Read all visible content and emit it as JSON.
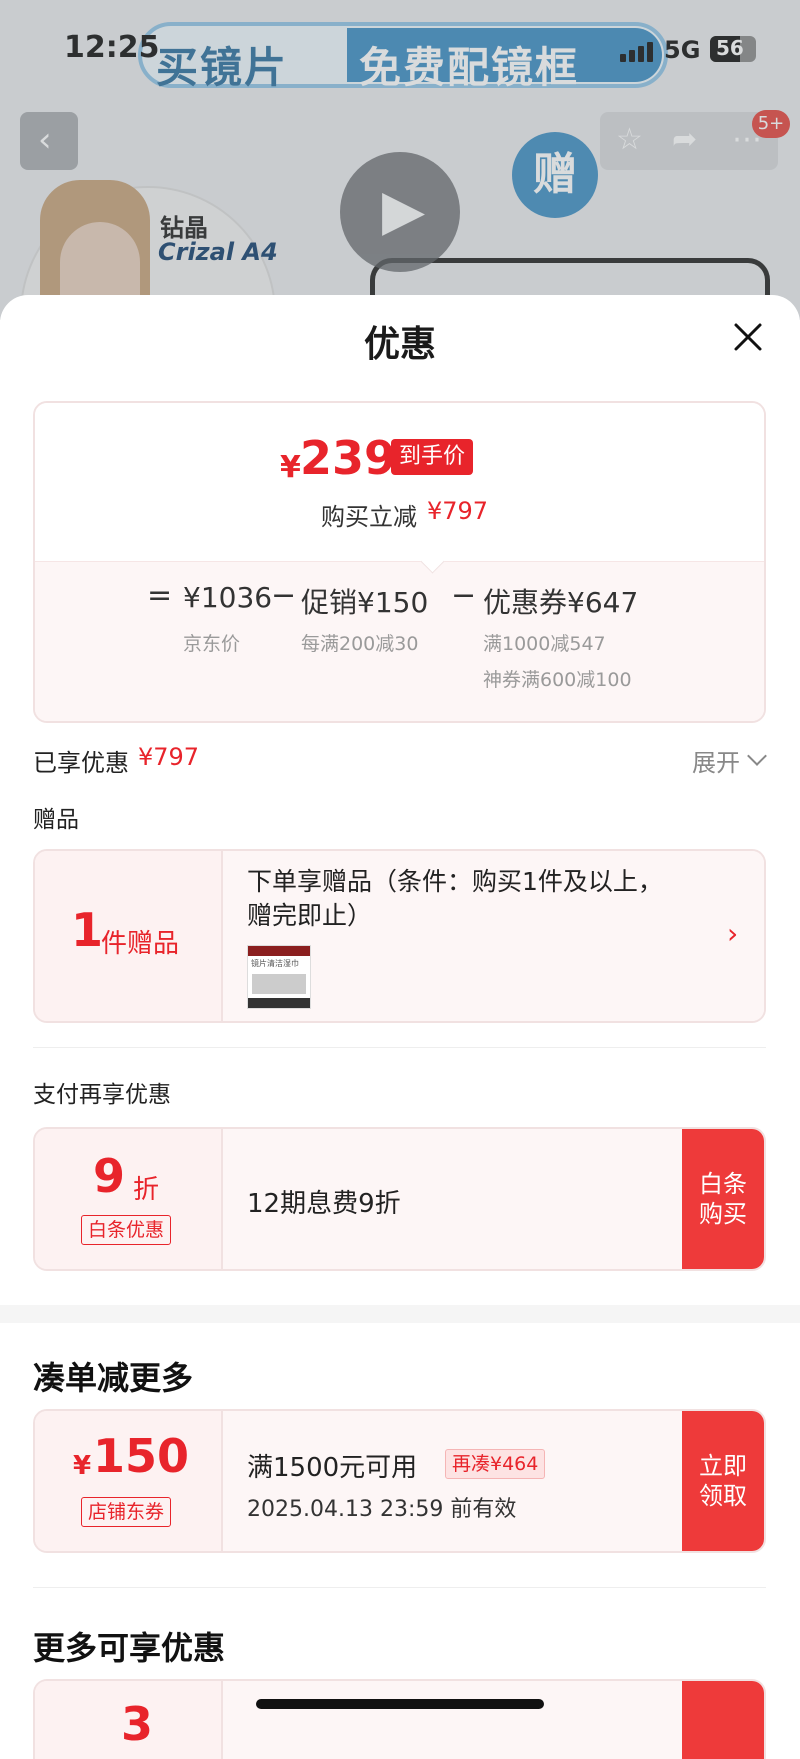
{
  "status_bar": {
    "time": "12:25",
    "network": "5G",
    "battery": "56"
  },
  "banner": {
    "left_text": "买镜片",
    "right_text": "免费配镜框"
  },
  "product_bg": {
    "gift_badge": "赠",
    "brand_cn": "钻晶",
    "brand_en": "Crizal A4",
    "notification_count": "5+"
  },
  "sheet": {
    "title": "优惠"
  },
  "summary": {
    "currency": "¥",
    "final_price": "239",
    "final_tag": "到手价",
    "reduce_label": "购买立减",
    "reduce_value": "¥797",
    "eq": "=",
    "minus": "−",
    "jd_price": "¥1036",
    "jd_price_label": "京东价",
    "promo": "促销¥150",
    "promo_sub": "每满200减30",
    "coupon": "优惠券¥647",
    "coupon_sub1": "满1000减547",
    "coupon_sub2": "神券满600减100"
  },
  "enjoyed": {
    "label": "已享优惠",
    "value": "¥797",
    "expand": "展开"
  },
  "gift": {
    "section": "赠品",
    "count": "1",
    "unit": "件赠品",
    "desc": "下单享赠品（条件：购买1件及以上，赠完即止）",
    "thumb_text": "镜片清洁湿巾"
  },
  "pay": {
    "section": "支付再享优惠",
    "discount": "9",
    "discount_unit": "折",
    "tag": "白条优惠",
    "desc": "12期息费9折",
    "cta_line1": "白条",
    "cta_line2": "购买"
  },
  "more_section": "凑单减更多",
  "coupon_card": {
    "currency": "¥",
    "amount": "150",
    "tag": "店铺东券",
    "cond": "满1500元可用",
    "extra": "再凑¥464",
    "expire": "2025.04.13 23:59 前有效",
    "cta_line1": "立即",
    "cta_line2": "领取"
  },
  "more_enjoy_section": "更多可享优惠",
  "partial_card": {
    "amount": "3"
  },
  "colors": {
    "accent": "#e8242b",
    "cta": "#ee3a3a",
    "card_bg": "#fdf6f6"
  }
}
